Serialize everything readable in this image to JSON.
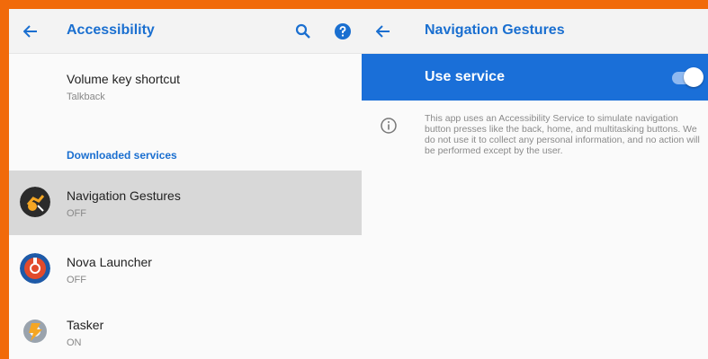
{
  "left": {
    "title": "Accessibility",
    "volume_row": {
      "primary": "Volume key shortcut",
      "secondary": "Talkback"
    },
    "section_label": "Downloaded services",
    "services": [
      {
        "name": "Navigation Gestures",
        "status": "OFF",
        "icon": "navigation-gestures-app-icon"
      },
      {
        "name": "Nova Launcher",
        "status": "OFF",
        "icon": "nova-launcher-app-icon"
      },
      {
        "name": "Tasker",
        "status": "ON",
        "icon": "tasker-app-icon"
      }
    ]
  },
  "right": {
    "title": "Navigation Gestures",
    "use_service_label": "Use service",
    "toggle_on": true,
    "description": "This app uses an Accessibility Service to simulate navigation button presses like the back, home, and multitasking buttons. We do not use it to collect any personal information, and no action will be performed except by the user."
  },
  "colors": {
    "accent": "#1a6fd8",
    "border": "#f16a0a",
    "selected_row": "#d8d8d8"
  }
}
